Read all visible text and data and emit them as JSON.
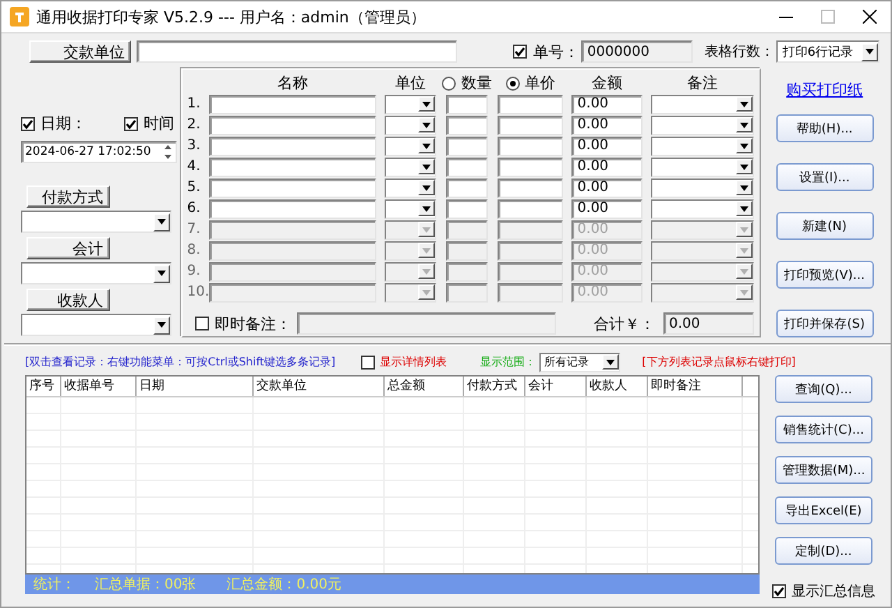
{
  "window": {
    "title": "通用收据打印专家 V5.2.9 --- 用户名：admin（管理员）"
  },
  "payer_button": "交款单位",
  "receipt_no": {
    "label": "单号：",
    "checked": true,
    "value": "0000000"
  },
  "table_rows_setting": {
    "label": "表格行数：",
    "value": "打印6行记录"
  },
  "date": {
    "label": "日期：",
    "checked": true
  },
  "time": {
    "label": "时间",
    "checked": true
  },
  "datetime": {
    "value": "2024-06-27 17:02:50"
  },
  "side_fields": [
    {
      "button": "付款方式"
    },
    {
      "button": "会计"
    },
    {
      "button": "收款人"
    }
  ],
  "items": {
    "headers": {
      "name": "名称",
      "unit": "单位",
      "amount": "金额",
      "note": "备注"
    },
    "price_mode": [
      {
        "label": "数量",
        "selected": false
      },
      {
        "label": "单价",
        "selected": true
      }
    ],
    "rows": [
      {
        "number": "1.",
        "amount": "0.00",
        "disabled": false
      },
      {
        "number": "2.",
        "amount": "0.00",
        "disabled": false
      },
      {
        "number": "3.",
        "amount": "0.00",
        "disabled": false
      },
      {
        "number": "4.",
        "amount": "0.00",
        "disabled": false
      },
      {
        "number": "5.",
        "amount": "0.00",
        "disabled": false
      },
      {
        "number": "6.",
        "amount": "0.00",
        "disabled": false
      },
      {
        "number": "7.",
        "amount": "0.00",
        "disabled": true
      },
      {
        "number": "8.",
        "amount": "0.00",
        "disabled": true
      },
      {
        "number": "9.",
        "amount": "0.00",
        "disabled": true
      },
      {
        "number": "10.",
        "amount": "0.00",
        "disabled": true
      }
    ],
    "remark": {
      "label": "即时备注：",
      "checked": false
    },
    "total_label": "合计￥：",
    "total": "0.00"
  },
  "buy_paper_link": "购买打印纸",
  "actions": [
    "帮助(H)...",
    "设置(I)...",
    "新建(N)",
    "打印预览(V)...",
    "打印并保存(S)"
  ],
  "records": {
    "hint": "[双击查看记录：右键功能菜单：可按Ctrl或Shift键选多条记录]",
    "details": {
      "label": "显示详情列表",
      "checked": false
    },
    "range_label": "显示范围：",
    "range": "所有记录",
    "print_hint": "[下方列表记录点鼠标右键打印]",
    "columns": [
      "序号",
      "收据单号",
      "日期",
      "交款单位",
      "总金额",
      "付款方式",
      "会计",
      "收款人",
      "即时备注"
    ],
    "summary": {
      "label": "统计：",
      "count": "汇总单据：00张",
      "total": "汇总金额：0.00元"
    }
  },
  "record_actions": [
    "查询(Q)...",
    "销售统计(C)...",
    "管理数据(M)...",
    "导出Excel(E)",
    "定制(D)..."
  ],
  "show_summary": {
    "label": "显示汇总信息",
    "checked": true
  }
}
